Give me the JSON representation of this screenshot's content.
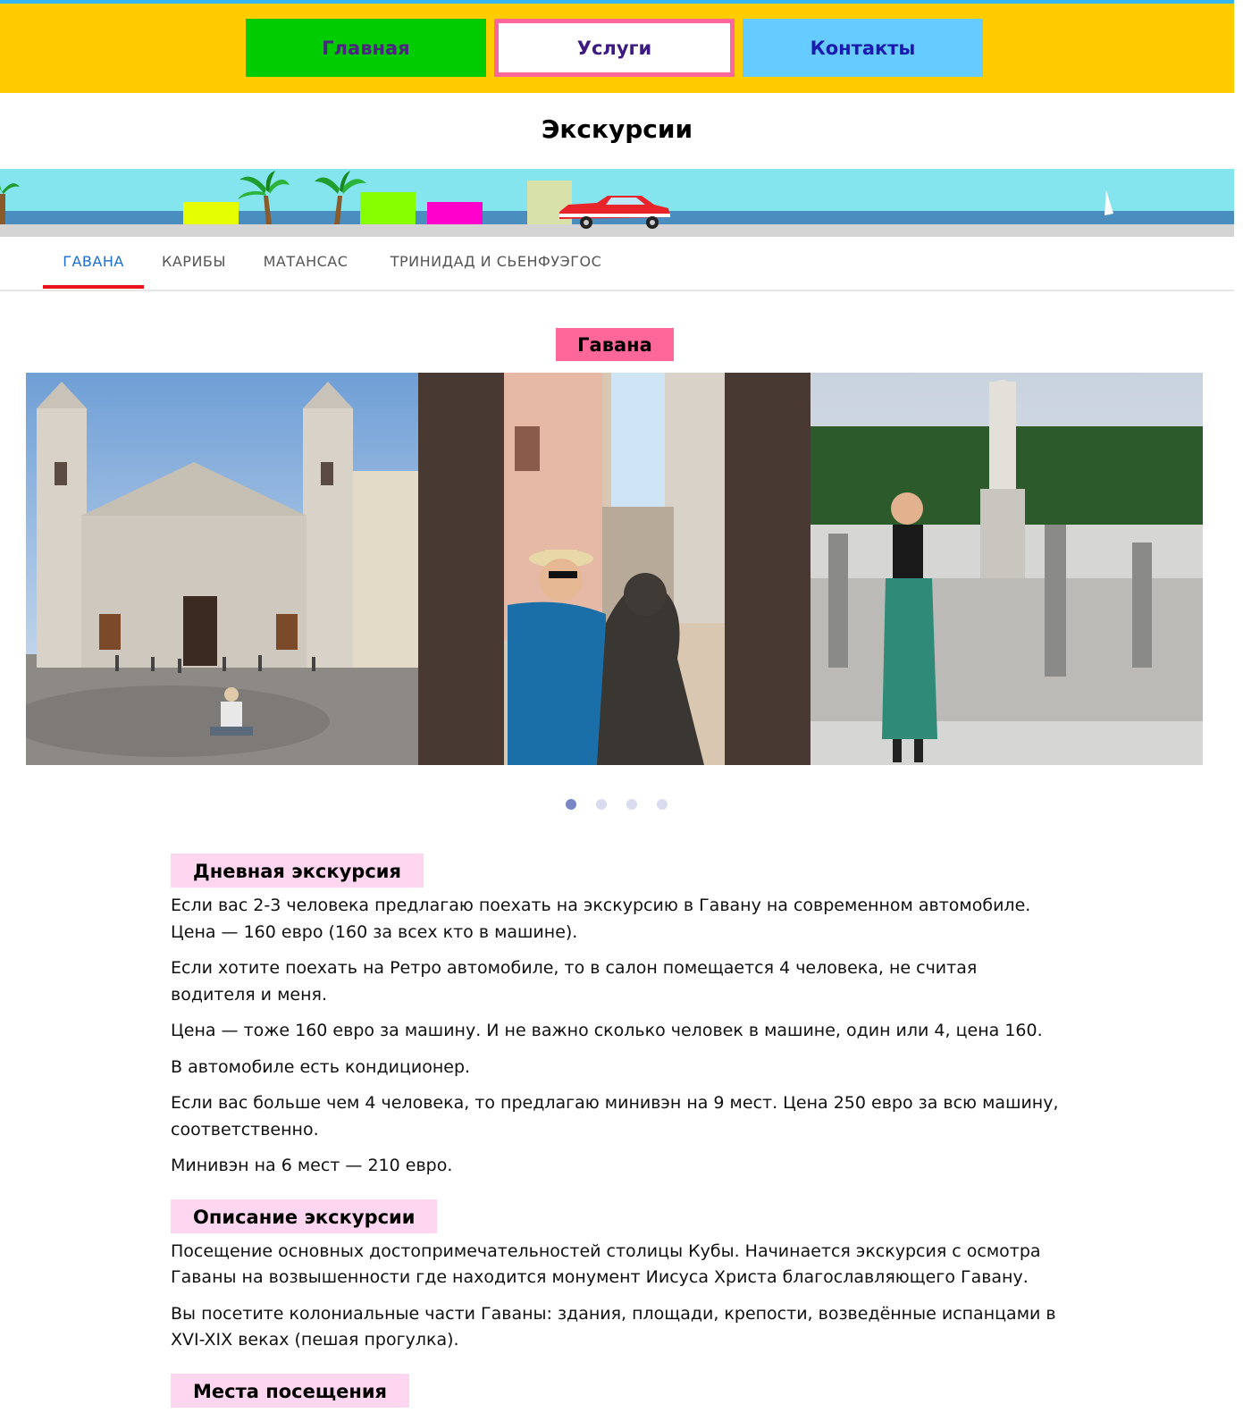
{
  "nav": {
    "home": "Главная",
    "services": "Услуги",
    "contacts": "Контакты"
  },
  "page": {
    "title": "Экскурсии"
  },
  "tabs": [
    {
      "label": "ГАВАНА",
      "active": true
    },
    {
      "label": "КАРИБЫ",
      "active": false
    },
    {
      "label": "МАТАНСАС",
      "active": false
    },
    {
      "label": "ТРИНИДАД И СЬЕНФУЭГОС",
      "active": false
    }
  ],
  "gallery": {
    "badge": "Гавана",
    "slides": [
      "cathedral-photo",
      "street-statue-photo",
      "cemetery-photo"
    ],
    "dots": 4,
    "active_dot": 1
  },
  "sections": [
    {
      "heading": "Дневная экскурсия",
      "paragraphs": [
        "Если вас 2-3 человека предлагаю поехать на экскурсию в Гавану на современном автомобиле. Цена — 160 евро (160 за всех кто в машине).",
        "Если хотите поехать на Ретро автомобиле, то в салон помещается 4 человека, не считая водителя и меня.",
        "Цена — тоже 160 евро за машину. И не важно сколько человек в машине, один или 4, цена 160.",
        "В автомобиле есть кондиционер.",
        "Если вас больше чем 4 человека, то предлагаю минивэн на 9 мест. Цена 250 евро за всю машину, соответственно.",
        "Минивэн на 6 мест — 210 евро."
      ]
    },
    {
      "heading": "Описание экскурсии",
      "paragraphs": [
        "Посещение основных достопримечательностей столицы Кубы. Начинается экскурсия с осмотра Гаваны на возвышенности где находится монумент Иисуса Христа благославляющего Гавану.",
        "Вы посетите колониальные части Гаваны: здания, площади, крепости, возведённые испанцами в XVI-XIX веках (пешая прогулка)."
      ]
    },
    {
      "heading": "Места посещения",
      "paragraphs": []
    }
  ],
  "colors": {
    "header_bg": "#ffcc00",
    "home_bg": "#00cc00",
    "contacts_bg": "#66ccff",
    "accent_pink": "#ff6699",
    "tab_active": "#1a6fd1",
    "tab_underline": "#e8131a"
  }
}
